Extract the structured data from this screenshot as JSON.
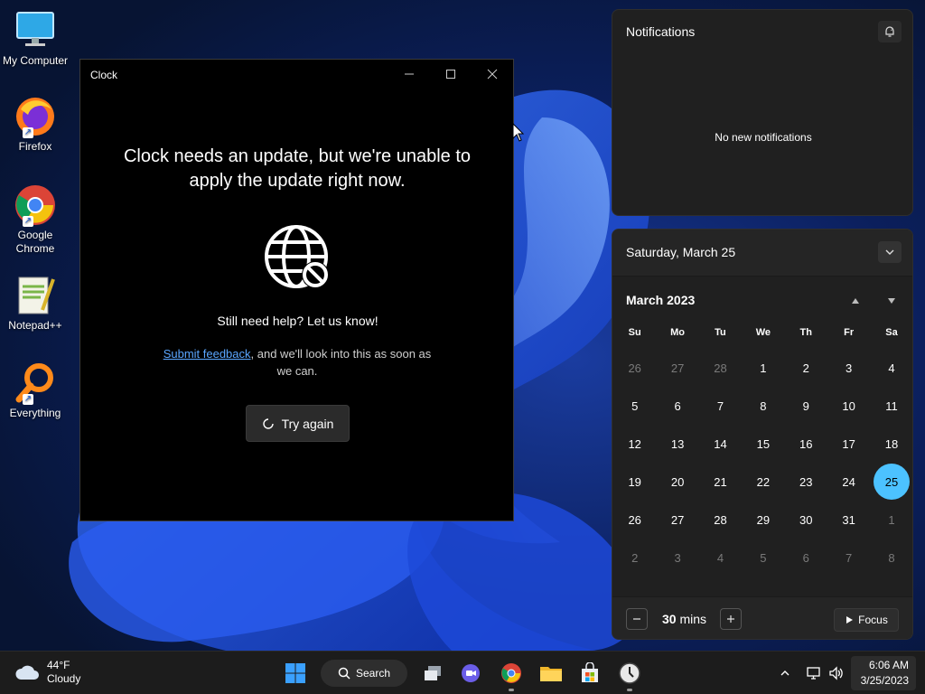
{
  "colors": {
    "accent": "#4cc2ff",
    "link": "#5aa6ff",
    "panel_bg": "#202020",
    "window_bg": "#000000",
    "taskbar_bg": "#1c1c1c"
  },
  "desktop": {
    "icons": [
      {
        "label": "My Computer",
        "icon": "monitor-icon"
      },
      {
        "label": "Firefox",
        "icon": "firefox-icon"
      },
      {
        "label": "Google Chrome",
        "icon": "chrome-icon"
      },
      {
        "label": "Notepad++",
        "icon": "notepad-plus-plus-icon"
      },
      {
        "label": "Everything",
        "icon": "everything-search-icon"
      }
    ]
  },
  "clock_window": {
    "title": "Clock",
    "heading": "Clock needs an update, but we're unable to apply the update right now.",
    "help": "Still need help? Let us know!",
    "feedback_link": "Submit feedback",
    "feedback_rest": ", and we'll look into this as soon as we can.",
    "try_again": "Try again"
  },
  "notifications": {
    "title": "Notifications",
    "empty_text": "No new notifications"
  },
  "calendar": {
    "date_header": "Saturday, March 25",
    "month_label": "March 2023",
    "weekdays": [
      "Su",
      "Mo",
      "Tu",
      "We",
      "Th",
      "Fr",
      "Sa"
    ],
    "weeks": [
      [
        "26",
        "27",
        "28",
        "1",
        "2",
        "3",
        "4"
      ],
      [
        "5",
        "6",
        "7",
        "8",
        "9",
        "10",
        "11"
      ],
      [
        "12",
        "13",
        "14",
        "15",
        "16",
        "17",
        "18"
      ],
      [
        "19",
        "20",
        "21",
        "22",
        "23",
        "24",
        "25"
      ],
      [
        "26",
        "27",
        "28",
        "29",
        "30",
        "31",
        "1"
      ],
      [
        "2",
        "3",
        "4",
        "5",
        "6",
        "7",
        "8"
      ]
    ],
    "selected_day": "25",
    "focus": {
      "value": "30",
      "unit": "mins",
      "button": "Focus"
    }
  },
  "taskbar": {
    "weather": {
      "temp": "44°F",
      "condition": "Cloudy",
      "icon": "cloud-icon"
    },
    "search_label": "Search",
    "apps": [
      "start-icon",
      "task-view-icon",
      "teams-chat-icon",
      "chrome-icon",
      "file-explorer-icon",
      "store-icon",
      "clock-app-icon"
    ],
    "time": "6:06 AM",
    "date": "3/25/2023"
  }
}
